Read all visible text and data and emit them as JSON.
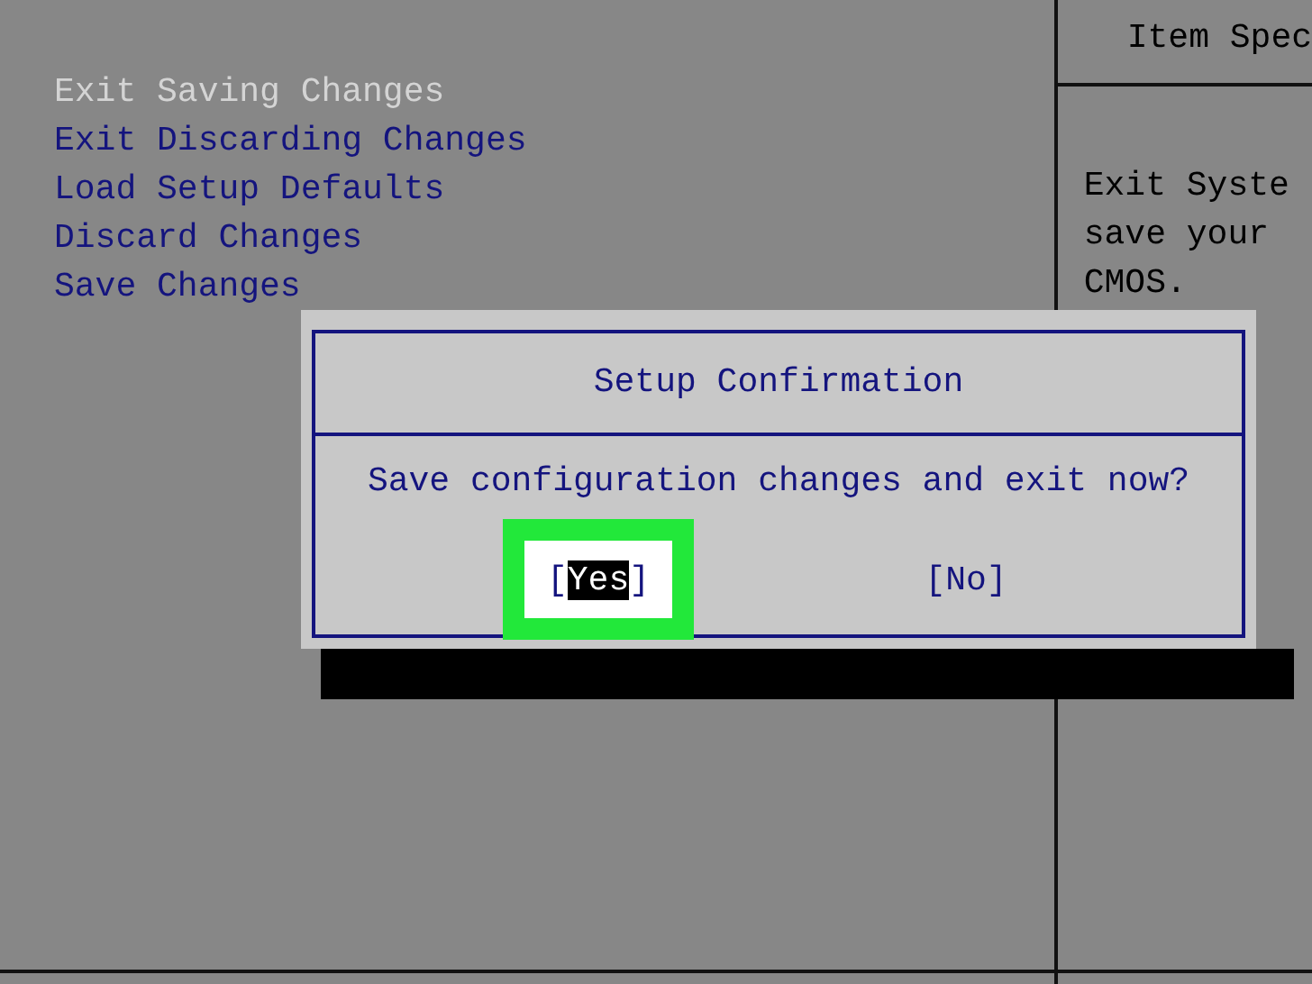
{
  "menu": {
    "items": [
      {
        "label": "Exit Saving Changes",
        "selected": true
      },
      {
        "label": "Exit Discarding Changes",
        "selected": false
      },
      {
        "label": "Load Setup Defaults",
        "selected": false
      },
      {
        "label": "Discard Changes",
        "selected": false
      },
      {
        "label": "Save Changes",
        "selected": false
      }
    ]
  },
  "help_panel": {
    "title": "Item Spec",
    "lines": [
      "Exit Syste",
      "save your",
      "CMOS."
    ]
  },
  "dialog": {
    "title": "Setup Confirmation",
    "message": "Save configuration changes and exit now?",
    "buttons": [
      {
        "open": "[",
        "label": "Yes",
        "close": "]",
        "selected": true,
        "highlighted": true
      },
      {
        "open": "[",
        "label": "No",
        "close": "]",
        "selected": false,
        "highlighted": false
      }
    ]
  }
}
